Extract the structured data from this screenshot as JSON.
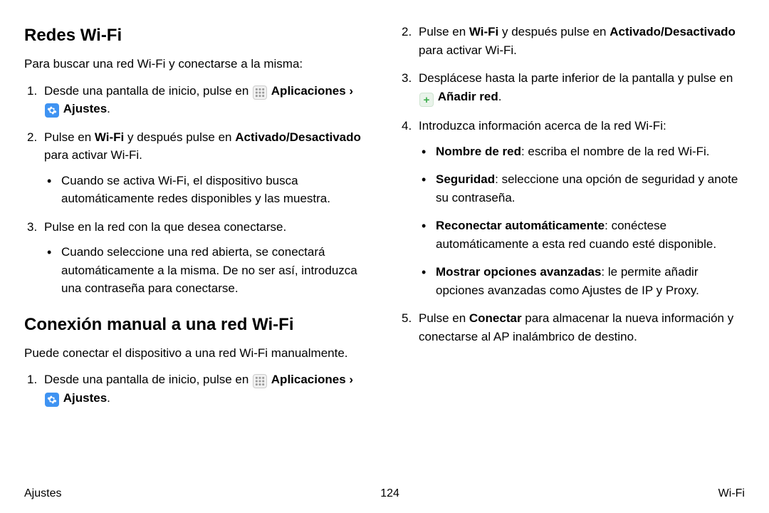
{
  "section1": {
    "heading": "Redes Wi-Fi",
    "intro": "Para buscar una red Wi-Fi y conectarse a la misma:",
    "step1_a": "Desde una pantalla de inicio, pulse en ",
    "step1_apps": "Aplicaciones",
    "step1_sep": " › ",
    "step1_ajustes": "Ajustes",
    "step1_end": ".",
    "step2_a": "Pulse en ",
    "step2_wifi": "Wi-Fi",
    "step2_b": " y después pulse en ",
    "step2_toggle": "Activado/Desactivado",
    "step2_c": " para activar Wi-Fi.",
    "step2_bullet": "Cuando se activa Wi-Fi, el dispositivo busca automáticamente redes disponibles y las muestra.",
    "step3": "Pulse en la red con la que desea conectarse.",
    "step3_bullet": "Cuando seleccione una red abierta, se conectará automáticamente a la misma. De no ser así, introduzca una contraseña para conectarse."
  },
  "section2": {
    "heading": "Conexión manual a una red Wi-Fi",
    "intro": "Puede conectar el dispositivo a una red Wi-Fi manualmente.",
    "step1_a": "Desde una pantalla de inicio, pulse en ",
    "step1_apps": "Aplicaciones",
    "step1_sep": " › ",
    "step1_ajustes": "Ajustes",
    "step1_end": ".",
    "step2_a": "Pulse en ",
    "step2_wifi": "Wi-Fi",
    "step2_b": " y después pulse en ",
    "step2_toggle": "Activado/Desactivado",
    "step2_c": " para activar Wi-Fi.",
    "step3_a": "Desplácese hasta la parte inferior de la pantalla y pulse en ",
    "step3_add": "Añadir red",
    "step3_end": ".",
    "step4": "Introduzca información acerca de la red Wi-Fi:",
    "b1_label": "Nombre de red",
    "b1_text": ": escriba el nombre de la red Wi-Fi.",
    "b2_label": "Seguridad",
    "b2_text": ": seleccione una opción de seguridad y anote su contraseña.",
    "b3_label": "Reconectar automáticamente",
    "b3_text": ": conéctese automáticamente a esta red cuando esté disponible.",
    "b4_label": "Mostrar opciones avanzadas",
    "b4_text": ": le permite añadir opciones avanzadas como Ajustes de IP y Proxy.",
    "step5_a": "Pulse en ",
    "step5_conectar": "Conectar",
    "step5_b": " para almacenar la nueva información y conectarse al AP inalámbrico de destino."
  },
  "footer": {
    "left": "Ajustes",
    "center": "124",
    "right": "Wi-Fi"
  }
}
